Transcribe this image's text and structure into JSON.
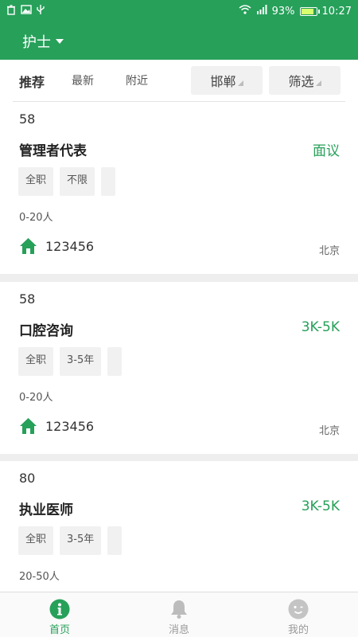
{
  "status_bar": {
    "battery_percent": "93%",
    "time": "10:27",
    "battery_level": 0.93,
    "left_icons": [
      "trash-icon",
      "image-icon",
      "usb-icon"
    ],
    "right_icons": [
      "wifi-icon",
      "signal-icon",
      "battery-icon"
    ]
  },
  "header": {
    "category": "护士"
  },
  "filters": {
    "tabs": [
      "推荐",
      "最新",
      "附近"
    ],
    "city": "邯郸",
    "filter": "筛选"
  },
  "jobs": [
    {
      "id": "58",
      "title": "管理者代表",
      "salary": "面议",
      "tags": [
        "全职",
        "不限",
        ""
      ],
      "company_size": "0-20人",
      "company": "123456",
      "city": "北京"
    },
    {
      "id": "58",
      "title": "口腔咨询",
      "salary": "3K-5K",
      "tags": [
        "全职",
        "3-5年",
        ""
      ],
      "company_size": "0-20人",
      "company": "123456",
      "city": "北京"
    },
    {
      "id": "80",
      "title": "执业医师",
      "salary": "3K-5K",
      "tags": [
        "全职",
        "3-5年",
        ""
      ],
      "company_size": "20-50人",
      "company": "",
      "city": ""
    }
  ],
  "tabbar": {
    "items": [
      {
        "label": "首页",
        "icon": "info-icon"
      },
      {
        "label": "消息",
        "icon": "bell-icon"
      },
      {
        "label": "我的",
        "icon": "face-icon"
      }
    ],
    "active": "首页"
  },
  "colors": {
    "accent": "#27a05a",
    "background": "#eeeeee"
  }
}
